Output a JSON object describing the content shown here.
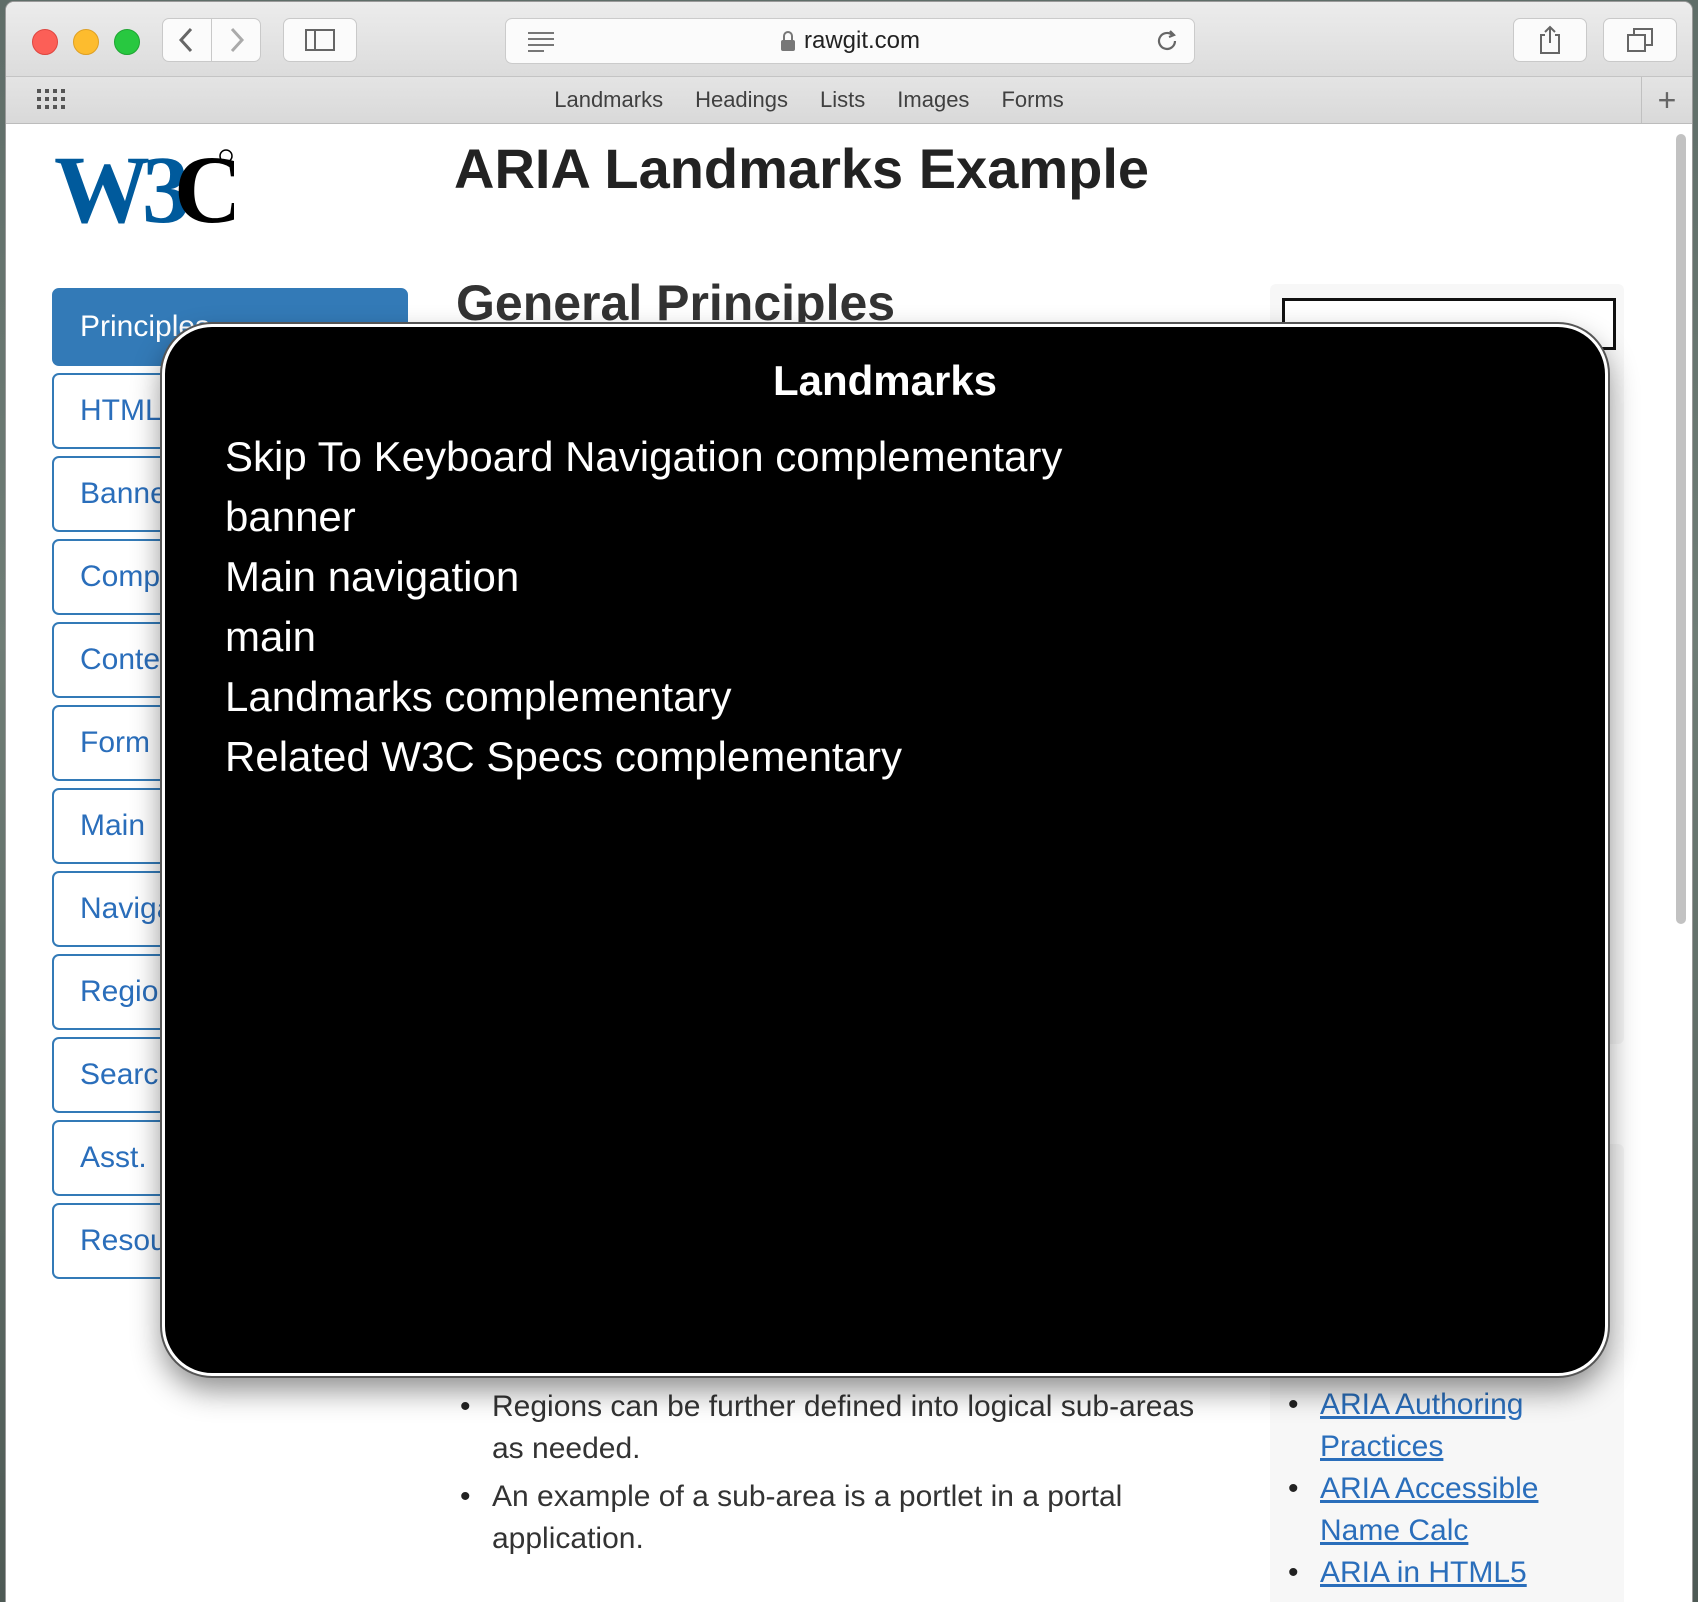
{
  "browser": {
    "url": "rawgit.com",
    "bookmarks": [
      "Landmarks",
      "Headings",
      "Lists",
      "Images",
      "Forms"
    ]
  },
  "page": {
    "title": "ARIA Landmarks Example",
    "section_heading": "General Principles",
    "nav_items": [
      "Principles",
      "HTML",
      "Banner",
      "Complementary",
      "Contentinfo",
      "Form",
      "Main",
      "Navigation",
      "Region",
      "Search",
      "Asst.",
      "Resources"
    ],
    "body_bullets": [
      "Regions can be further defined into logical sub-areas as needed.",
      "An example of a sub-area is a portlet in a portal application."
    ],
    "related_links": [
      "ARIA Authoring Practices",
      "ARIA Accessible Name Calc",
      "ARIA in HTML5"
    ]
  },
  "overlay": {
    "title": "Landmarks",
    "items": [
      "Skip To Keyboard Navigation complementary",
      "banner",
      "Main navigation",
      "main",
      "Landmarks complementary",
      "Related W3C Specs complementary"
    ]
  },
  "colors": {
    "nav_accent": "#337ab7",
    "link": "#2a6ebb",
    "overlay_bg": "#000000"
  }
}
